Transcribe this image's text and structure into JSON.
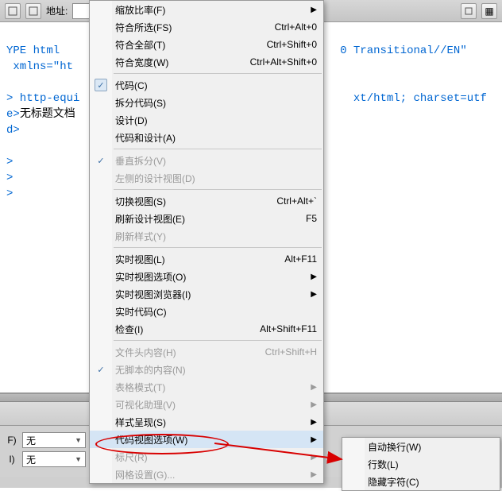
{
  "toolbar": {
    "addr_label": "地址:"
  },
  "code": {
    "l1a": "YPE html ",
    "l1b": "0 Transitional//EN\"",
    "l2": " xmlns=\"ht",
    "l3": "> http-equi",
    "l3b": "xt/html; charset=utf",
    "l4a": "e>",
    "l4b": "无标题文档",
    "l5": "d>",
    "l6": ">",
    "l7": ">",
    "l8": ">"
  },
  "props": {
    "f_label": "F)",
    "f_value": "无",
    "i_label": "I)",
    "i_value": "无"
  },
  "menu": {
    "g1": [
      {
        "label": "缩放比率(F)",
        "sub": true
      },
      {
        "label": "符合所选(FS)",
        "shortcut": "Ctrl+Alt+0"
      },
      {
        "label": "符合全部(T)",
        "shortcut": "Ctrl+Shift+0"
      },
      {
        "label": "符合宽度(W)",
        "shortcut": "Ctrl+Alt+Shift+0"
      }
    ],
    "g2": [
      {
        "label": "代码(C)",
        "checked": true
      },
      {
        "label": "拆分代码(S)"
      },
      {
        "label": "设计(D)"
      },
      {
        "label": "代码和设计(A)"
      }
    ],
    "g3": [
      {
        "label": "垂直拆分(V)",
        "disabled": true,
        "dcheck": true
      },
      {
        "label": "左侧的设计视图(D)",
        "disabled": true
      }
    ],
    "g4": [
      {
        "label": "切换视图(S)",
        "shortcut": "Ctrl+Alt+`"
      },
      {
        "label": "刷新设计视图(E)",
        "shortcut": "F5"
      },
      {
        "label": "刷新样式(Y)",
        "disabled": true
      }
    ],
    "g5": [
      {
        "label": "实时视图(L)",
        "shortcut": "Alt+F11"
      },
      {
        "label": "实时视图选项(O)",
        "sub": true
      },
      {
        "label": "实时视图浏览器(I)",
        "sub": true
      },
      {
        "label": "实时代码(C)"
      },
      {
        "label": "检查(I)",
        "shortcut": "Alt+Shift+F11"
      }
    ],
    "g6": [
      {
        "label": "文件头内容(H)",
        "disabled": true,
        "shortcut": "Ctrl+Shift+H"
      },
      {
        "label": "无脚本的内容(N)",
        "disabled": true,
        "dcheck": true
      },
      {
        "label": "表格模式(T)",
        "disabled": true,
        "sub": true
      },
      {
        "label": "可视化助理(V)",
        "disabled": true,
        "sub": true
      },
      {
        "label": "样式呈现(S)",
        "sub": true
      },
      {
        "label": "代码视图选项(W)",
        "sub": true,
        "highlight": true
      },
      {
        "label": "标尺(R)",
        "disabled": true,
        "sub": true
      },
      {
        "label": "网格设置(G)...",
        "disabled": true,
        "sub": true
      }
    ]
  },
  "submenu": [
    {
      "label": "自动换行(W)"
    },
    {
      "label": "行数(L)"
    },
    {
      "label": "隐藏字符(C)"
    }
  ]
}
